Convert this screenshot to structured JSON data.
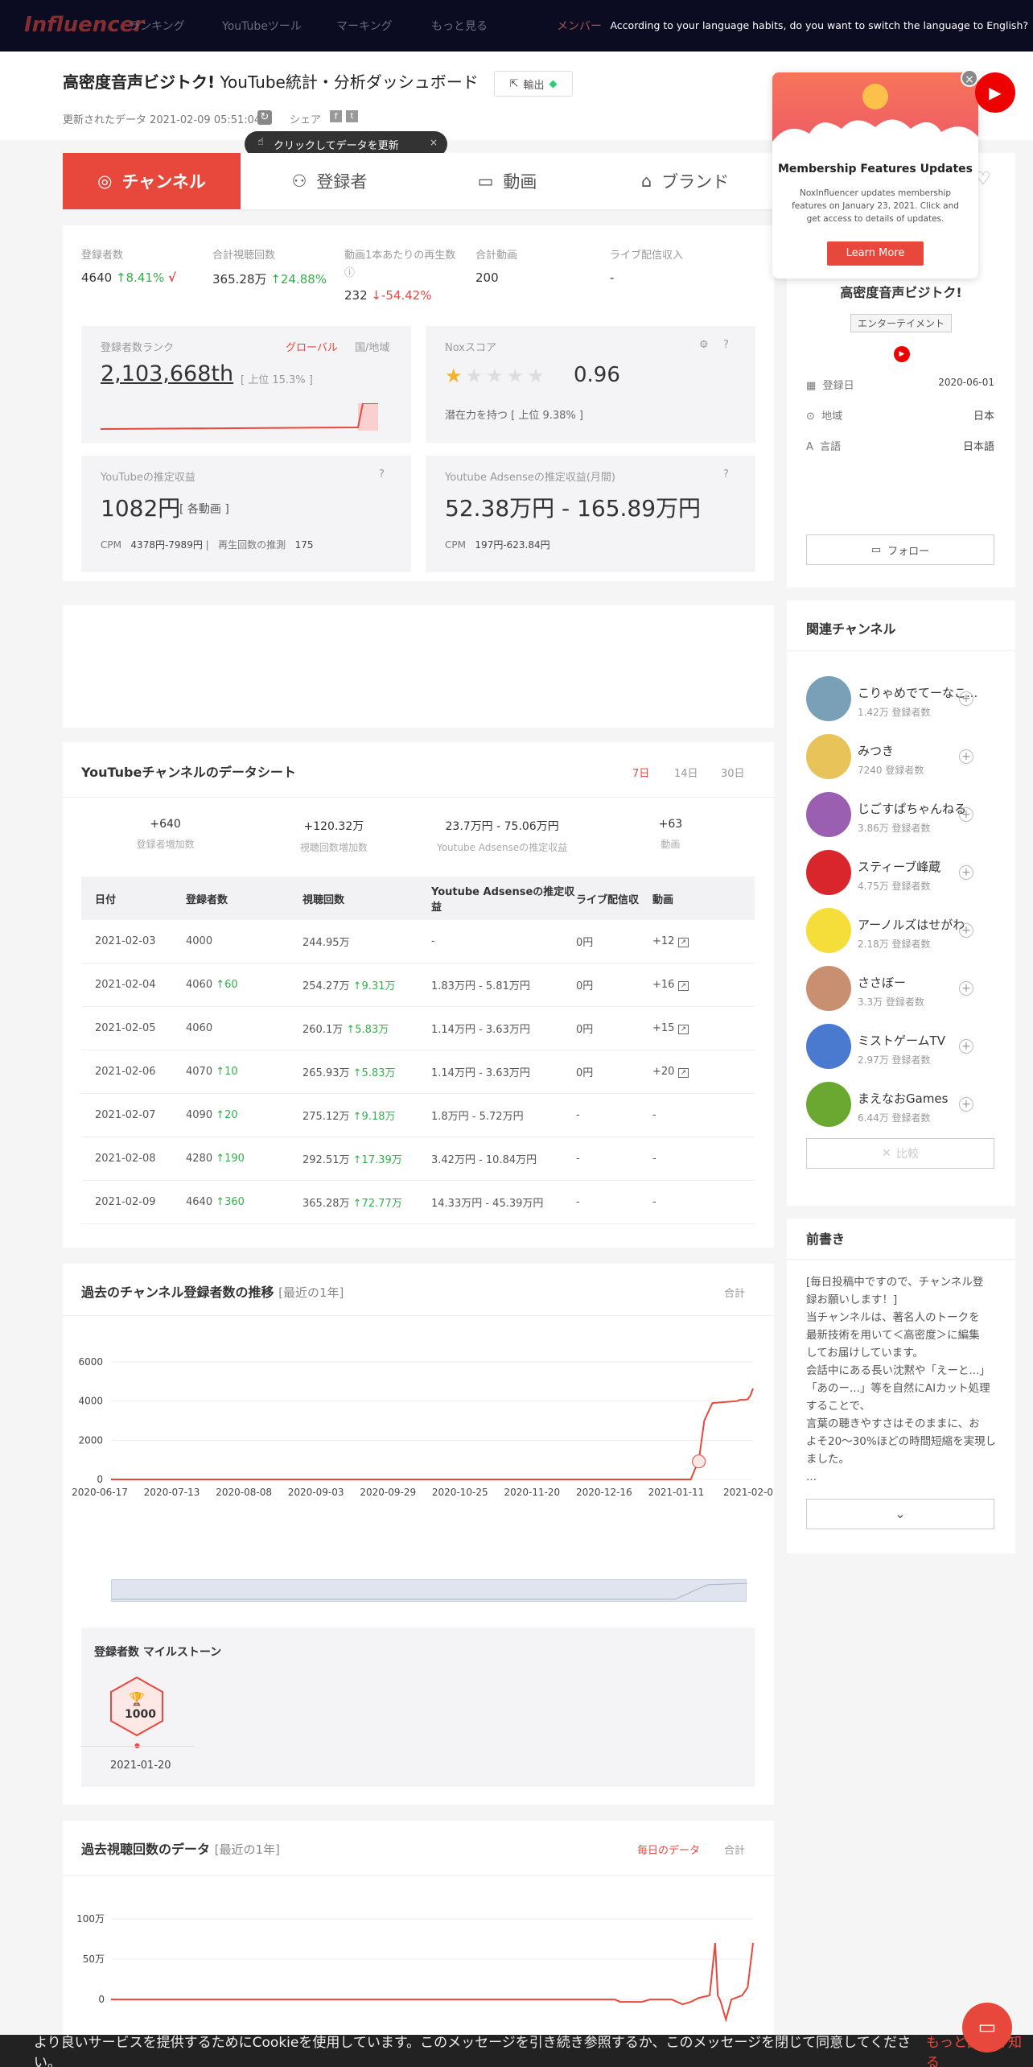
{
  "nav": {
    "logo": "Influencer",
    "items": [
      "ランキング",
      "YouTubeツール",
      "マーキング",
      "もっと見る",
      "メンバー"
    ],
    "language_prompt": "According to your language habits, do you want to switch the language to English?"
  },
  "header": {
    "channel_name": "高密度音声ビジトク!",
    "title_suffix": "YouTube統計・分析ダッシュボード",
    "export_label": "輸出",
    "updated_label": "更新されたデータ 2021-02-09 05:51:04",
    "share_label": "シェア",
    "tooltip": "クリックしてデータを更新"
  },
  "tabs": [
    "チャンネル",
    "登録者",
    "動画",
    "ブランド"
  ],
  "stats": {
    "subs_label": "登録者数",
    "subs_value": "4640",
    "subs_change": "8.41%",
    "views_label": "合計視聴回数",
    "views_value": "365.28万",
    "views_change": "24.88%",
    "avg_label": "動画1本あたりの再生数",
    "avg_value": "232",
    "avg_change": "-54.42%",
    "videos_label": "合計動画",
    "videos_value": "200",
    "live_label": "ライブ配信収入",
    "live_value": "-"
  },
  "rank": {
    "label": "登録者数ランク",
    "global": "グローバル",
    "country": "国/地域",
    "value": "2,103,668th",
    "top": "[ 上位 15.3% ]"
  },
  "nox": {
    "label": "Noxスコア",
    "score": "0.96",
    "rating": 0.5,
    "potential": "潜在力を持つ [ 上位 9.38% ]"
  },
  "earnings": {
    "label": "YouTubeの推定収益",
    "value": "1082円",
    "per": "[ 各動画 ]",
    "cpm_label": "CPM",
    "cpm": "4378円-7989円",
    "plays_label": "再生回数の推測",
    "plays": "175"
  },
  "adsense": {
    "label": "Youtube Adsenseの推定収益(月間)",
    "value": "52.38万円 - 165.89万円",
    "cpm_label": "CPM",
    "cpm": "197円-623.84円"
  },
  "datasheet": {
    "title": "YouTubeチャンネルのデータシート",
    "ranges": [
      "7日",
      "14日",
      "30日"
    ],
    "summary": [
      {
        "value": "+640",
        "label": "登録者増加数"
      },
      {
        "value": "+120.32万",
        "label": "視聴回数増加数"
      },
      {
        "value": "23.7万円 - 75.06万円",
        "label": "Youtube Adsenseの推定収益"
      },
      {
        "value": "+63",
        "label": "動画"
      }
    ],
    "headers": [
      "日付",
      "登録者数",
      "視聴回数",
      "Youtube Adsenseの推定収益",
      "ライブ配信収",
      "動画"
    ],
    "rows": [
      [
        "2021-02-03",
        "4000",
        "",
        "244.95万",
        "",
        "-",
        "0円",
        "+12"
      ],
      [
        "2021-02-04",
        "4060",
        "60",
        "254.27万",
        "9.31万",
        "1.83万円 - 5.81万円",
        "0円",
        "+16"
      ],
      [
        "2021-02-05",
        "4060",
        "",
        "260.1万",
        "5.83万",
        "1.14万円 - 3.63万円",
        "0円",
        "+15"
      ],
      [
        "2021-02-06",
        "4070",
        "10",
        "265.93万",
        "5.83万",
        "1.14万円 - 3.63万円",
        "0円",
        "+20"
      ],
      [
        "2021-02-07",
        "4090",
        "20",
        "275.12万",
        "9.18万",
        "1.8万円 - 5.72万円",
        "-",
        "-"
      ],
      [
        "2021-02-08",
        "4280",
        "190",
        "292.51万",
        "17.39万",
        "3.42万円 - 10.84万円",
        "-",
        "-"
      ],
      [
        "2021-02-09",
        "4640",
        "360",
        "365.28万",
        "72.77万",
        "14.33万円 - 45.39万円",
        "-",
        "-"
      ]
    ]
  },
  "subs_chart": {
    "title": "過去のチャンネル登録者数の推移",
    "subtitle": "[最近の1年]",
    "toggle": "合計",
    "milestone_title": "登録者数 マイルストーン",
    "milestone_value": "1000",
    "milestone_date": "2021-01-20"
  },
  "views_chart": {
    "title": "過去視聴回数のデータ",
    "subtitle": "[最近の1年]",
    "toggle_daily": "毎日のデータ",
    "toggle_total": "合計"
  },
  "chart_data": [
    {
      "type": "line",
      "x_ticks": [
        "2020-06-17",
        "2020-07-13",
        "2020-08-08",
        "2020-09-03",
        "2020-09-29",
        "2020-10-25",
        "2020-11-20",
        "2020-12-16",
        "2021-01-11",
        "2021-02-0"
      ],
      "y_ticks": [
        "0",
        "2000",
        "4000",
        "6000"
      ],
      "ylim": [
        0,
        6000
      ],
      "x": [
        "2020-06-17",
        "2021-01-17",
        "2021-01-20",
        "2021-01-22",
        "2021-01-25",
        "2021-02-03",
        "2021-02-04",
        "2021-02-06",
        "2021-02-07",
        "2021-02-08",
        "2021-02-09"
      ],
      "y": [
        0,
        0,
        1000,
        3000,
        3900,
        4000,
        4060,
        4070,
        4090,
        4280,
        4640
      ],
      "color": "#e8483b"
    },
    {
      "type": "line",
      "y_ticks": [
        "0",
        "50万",
        "100万"
      ],
      "ylim": [
        -10,
        100
      ],
      "x": [
        "2020-06-17",
        "2020-12-20",
        "2020-12-22",
        "2020-12-30",
        "2021-01-02",
        "2021-01-10",
        "2021-01-14",
        "2021-01-17",
        "2021-01-20",
        "2021-01-24",
        "2021-01-26",
        "2021-01-27",
        "2021-01-28",
        "2021-01-30",
        "2021-02-01",
        "2021-02-05",
        "2021-02-07",
        "2021-02-09"
      ],
      "y": [
        0,
        0,
        -3,
        -3,
        0,
        0,
        -6,
        -3,
        2,
        5,
        70,
        5,
        -2,
        -25,
        0,
        5,
        15,
        70
      ],
      "color": "#e8483b"
    }
  ],
  "popup": {
    "title": "Membership Features Updates",
    "body": "NoxInfluencer updates membership features on January 23, 2021. Click and get access to details of updates.",
    "button": "Learn More"
  },
  "profile": {
    "name": "高密度音声ビジトク!",
    "category": "エンターテイメント",
    "reg_label": "登録日",
    "reg_value": "2020-06-01",
    "region_label": "地域",
    "region_value": "日本",
    "lang_label": "言語",
    "lang_value": "日本語",
    "follow": "フォロー"
  },
  "related": {
    "title": "関連チャンネル",
    "compare": "比較",
    "items": [
      {
        "name": "こりゃめでてーなこ...",
        "subs": "1.42万 登録者数",
        "color": "#7aa0b8"
      },
      {
        "name": "みつき",
        "subs": "7240 登録者数",
        "color": "#e8c35a"
      },
      {
        "name": "じごすぱちゃんねる",
        "subs": "3.86万 登録者数",
        "color": "#9a5fb0"
      },
      {
        "name": "スティーブ峰蔵",
        "subs": "4.75万 登録者数",
        "color": "#d8262c"
      },
      {
        "name": "アーノルズはせがわ",
        "subs": "2.18万 登録者数",
        "color": "#f5dd3a"
      },
      {
        "name": "ささぼー",
        "subs": "3.3万 登録者数",
        "color": "#c89070"
      },
      {
        "name": "ミストゲームTV",
        "subs": "2.97万 登録者数",
        "color": "#4a7ad0"
      },
      {
        "name": "まえなおGames",
        "subs": "6.44万 登録者数",
        "color": "#6aa832"
      }
    ]
  },
  "preface": {
    "title": "前書き",
    "lines": [
      "[毎日投稿中ですので、チャンネル登",
      "録お願いします！]",
      "当チャンネルは、著名人のトークを",
      "最新技術を用いて＜高密度＞に編集",
      "してお届けしています。",
      "会話中にある長い沈黙や「えーと...」",
      "「あのー...」等を自然にAIカット処理",
      "することで、",
      "言葉の聴きやすさはそのままに、お",
      "よそ20～30%ほどの時間短縮を実現し",
      "ました。",
      "..."
    ]
  },
  "cookie": {
    "text": "より良いサービスを提供するためにCookieを使用しています。このメッセージを引き続き参照するか、このメッセージを閉じて同意してください。",
    "more": "もっと詳しく知る"
  }
}
